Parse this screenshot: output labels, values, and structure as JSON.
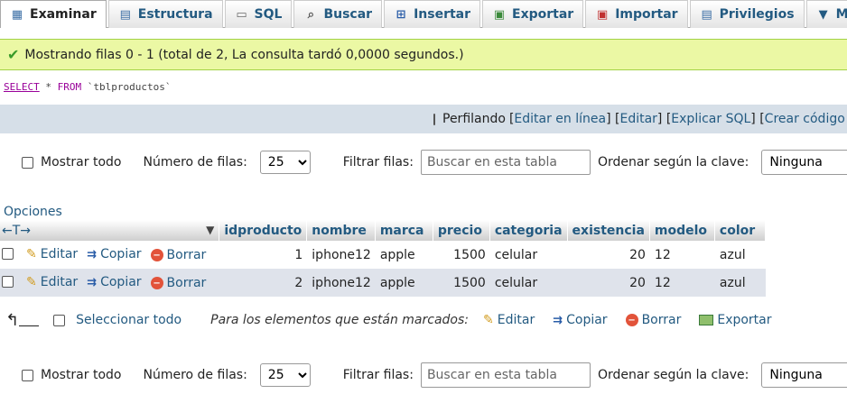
{
  "tabs": [
    {
      "label": "Examinar",
      "icon": "table-browse-icon",
      "active": true
    },
    {
      "label": "Estructura",
      "icon": "structure-icon"
    },
    {
      "label": "SQL",
      "icon": "sql-icon"
    },
    {
      "label": "Buscar",
      "icon": "search-icon"
    },
    {
      "label": "Insertar",
      "icon": "insert-icon"
    },
    {
      "label": "Exportar",
      "icon": "export-icon"
    },
    {
      "label": "Importar",
      "icon": "import-icon"
    },
    {
      "label": "Privilegios",
      "icon": "privileges-icon"
    },
    {
      "label": "Más",
      "icon": "chevron-down-icon"
    }
  ],
  "message": "Mostrando filas 0 - 1 (total de 2, La consulta tardó 0,0000 segundos.)",
  "sql": {
    "select": "SELECT",
    "star": " * ",
    "from": "FROM",
    "table": " `tblproductos`"
  },
  "profiling": {
    "label": "Perfilando",
    "links": [
      "Editar en línea",
      "Editar",
      "Explicar SQL",
      "Crear código P"
    ]
  },
  "nav": {
    "show_all": "Mostrar todo",
    "rows_label": "Número de filas:",
    "rows_value": "25",
    "filter_label": "Filtrar filas:",
    "filter_placeholder": "Buscar en esta tabla",
    "sort_label": "Ordenar según la clave:",
    "sort_value": "Ninguna"
  },
  "options_label": "Opciones",
  "columns": [
    "idproducto",
    "nombre",
    "marca",
    "precio",
    "categoria",
    "existencia",
    "modelo",
    "color"
  ],
  "row_actions": {
    "edit": "Editar",
    "copy": "Copiar",
    "delete": "Borrar"
  },
  "rows": [
    {
      "idproducto": "1",
      "nombre": "iphone12",
      "marca": "apple",
      "precio": "1500",
      "categoria": "celular",
      "existencia": "20",
      "modelo": "12",
      "color": "azul"
    },
    {
      "idproducto": "2",
      "nombre": "iphone12",
      "marca": "apple",
      "precio": "1500",
      "categoria": "celular",
      "existencia": "20",
      "modelo": "12",
      "color": "azul"
    }
  ],
  "bulk": {
    "select_all": "Seleccionar todo",
    "marked": "Para los elementos que están marcados:",
    "edit": "Editar",
    "copy": "Copiar",
    "delete": "Borrar",
    "export": "Exportar"
  },
  "colors": {
    "link": "#235a81",
    "success_bg": "#ebf8a4",
    "profbar_bg": "#d6dfe8",
    "row_alt": "#dfe3eb"
  }
}
